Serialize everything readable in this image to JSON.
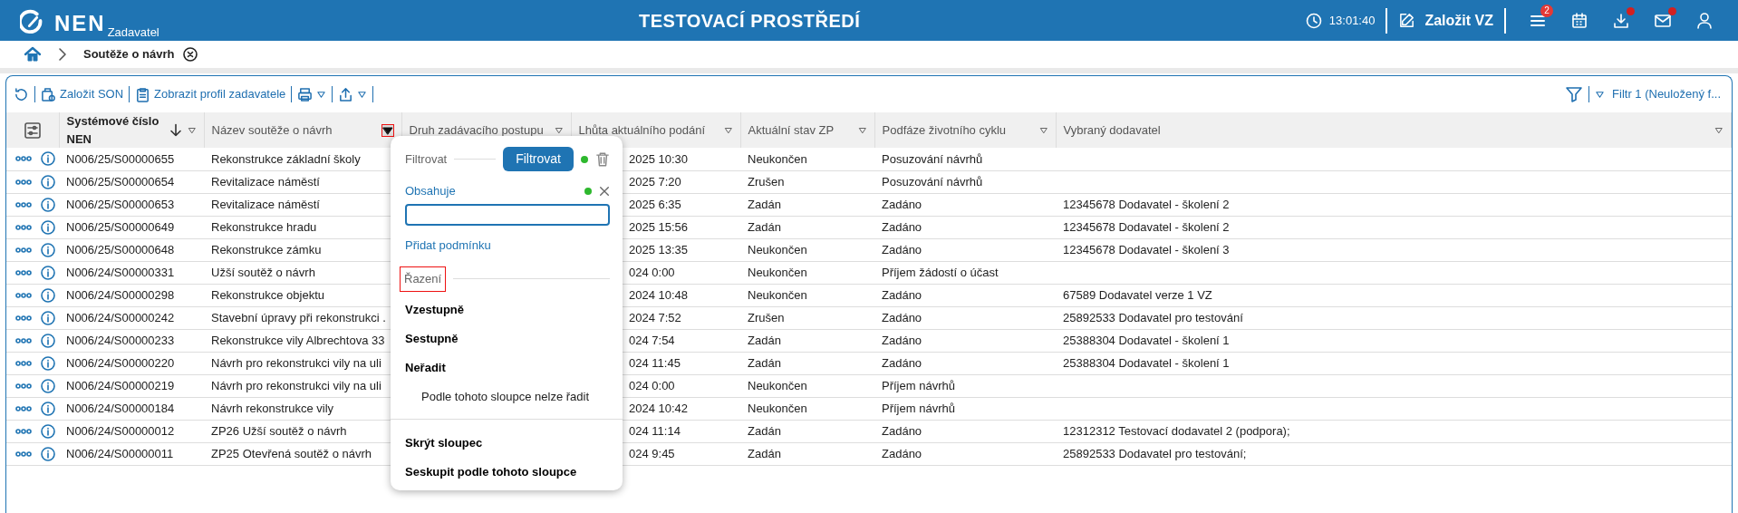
{
  "header": {
    "logo_text": "NEN",
    "logo_subtitle": "Zadavatel",
    "environment": "TESTOVACÍ PROSTŘEDÍ",
    "time": "13:01:40",
    "create_button": "Založit VZ",
    "notifications_badge": "2",
    "downloads_alert": true,
    "messages_alert": true
  },
  "breadcrumb": {
    "current": "Soutěže o návrh"
  },
  "toolbar": {
    "buttons": [
      {
        "label": "Založit SON",
        "kind": "create"
      },
      {
        "label": "Zobrazit profil zadavatele",
        "kind": "profile"
      }
    ],
    "filter_label": "Filtr 1 (Neuložený f..."
  },
  "table": {
    "columns": [
      {
        "label": "Systémové číslo NEN",
        "sorted": true,
        "menu_open": false
      },
      {
        "label": "Název soutěže o návrh",
        "menu_open": true
      },
      {
        "label": "Druh zadávacího postupu",
        "menu_open": false
      },
      {
        "label": "Lhůta aktuálního podání",
        "menu_open": false
      },
      {
        "label": "Aktuální stav ZP",
        "menu_open": false
      },
      {
        "label": "Podfáze životního cyklu",
        "menu_open": false
      },
      {
        "label": "Vybraný dodavatel",
        "menu_open": false
      }
    ],
    "rows": [
      {
        "number": "N006/25/S00000655",
        "name": "Rekonstrukce základní školy",
        "deadline": "2025 10:30",
        "state": "Neukončen",
        "subphase": "Posuzování návrhů"
      },
      {
        "number": "N006/25/S00000654",
        "name": "Revitalizace náměstí",
        "deadline": "2025 7:20",
        "state": "Zrušen",
        "subphase": "Posuzování návrhů"
      },
      {
        "number": "N006/25/S00000653",
        "name": "Revitalizace náměstí",
        "deadline": "2025 6:35",
        "state": "Zadán",
        "subphase": "Zadáno",
        "supplier": "12345678 Dodavatel - školení 2"
      },
      {
        "number": "N006/25/S00000649",
        "name": "Rekonstrukce hradu",
        "deadline": "2025 15:56",
        "state": "Zadán",
        "subphase": "Zadáno",
        "supplier": "12345678 Dodavatel - školení 2"
      },
      {
        "number": "N006/25/S00000648",
        "name": "Rekonstrukce zámku",
        "deadline": "2025 13:35",
        "state": "Neukončen",
        "subphase": "Zadáno",
        "supplier": "12345678 Dodavatel - školení 3"
      },
      {
        "number": "N006/24/S00000331",
        "name": "Užší soutěž o návrh",
        "deadline": "024 0:00",
        "state": "Neukončen",
        "subphase": "Příjem žádostí o účast"
      },
      {
        "number": "N006/24/S00000298",
        "name": "Rekonstrukce objektu",
        "deadline": "2024 10:48",
        "state": "Neukončen",
        "subphase": "Zadáno",
        "supplier": "67589 Dodavatel verze 1 VZ"
      },
      {
        "number": "N006/24/S00000242",
        "name": "Stavební úpravy při rekonstrukci .",
        "deadline": "2024 7:52",
        "state": "Zrušen",
        "subphase": "Zadáno",
        "supplier": "25892533 Dodavatel pro testování"
      },
      {
        "number": "N006/24/S00000233",
        "name": "Rekonstrukce vily Albrechtova 33",
        "deadline": "024 7:54",
        "state": "Zadán",
        "subphase": "Zadáno",
        "supplier": "25388304 Dodavatel - školení 1"
      },
      {
        "number": "N006/24/S00000220",
        "name": "Návrh pro rekonstrukci vily na uli",
        "deadline": "024 11:45",
        "state": "Zadán",
        "subphase": "Zadáno",
        "supplier": "25388304 Dodavatel - školení 1"
      },
      {
        "number": "N006/24/S00000219",
        "name": "Návrh pro rekonstrukci vily na uli",
        "deadline": "024 0:00",
        "state": "Neukončen",
        "subphase": "Příjem návrhů"
      },
      {
        "number": "N006/24/S00000184",
        "name": "Návrh rekonstrukce vily",
        "deadline": "2024 10:42",
        "state": "Neukončen",
        "subphase": "Příjem návrhů"
      },
      {
        "number": "N006/24/S00000012",
        "name": "ZP26 Užší soutěž o návrh",
        "deadline": "024 11:14",
        "state": "Zadán",
        "subphase": "Zadáno",
        "supplier": "12312312 Testovací dodavatel 2 (podpora);"
      },
      {
        "number": "N006/24/S00000011",
        "name": "ZP25 Otevřená soutěž o návrh",
        "deadline": "024 9:45",
        "state": "Zadán",
        "subphase": "Zadáno",
        "supplier": "25892533 Dodavatel pro testování;"
      }
    ]
  },
  "column_menu": {
    "filter_label": "Filtrovat",
    "filter_button": "Filtrovat",
    "filter_active": true,
    "conditions": [
      {
        "operator": "Obsahuje",
        "active": true,
        "focused": true
      }
    ],
    "add_condition": "Přidat podmínku",
    "sort_label": "Řazení",
    "sort_label_highlighted": true,
    "sort_options": [
      {
        "label": "Vzestupně",
        "kind": "option"
      },
      {
        "label": "Sestupně",
        "kind": "option"
      },
      {
        "label": "Neřadit",
        "kind": "option"
      },
      {
        "label": "Podle tohoto sloupce nelze řadit",
        "kind": "note"
      }
    ],
    "actions": [
      "Skrýt sloupec",
      "Seskupit podle tohoto sloupce"
    ]
  }
}
